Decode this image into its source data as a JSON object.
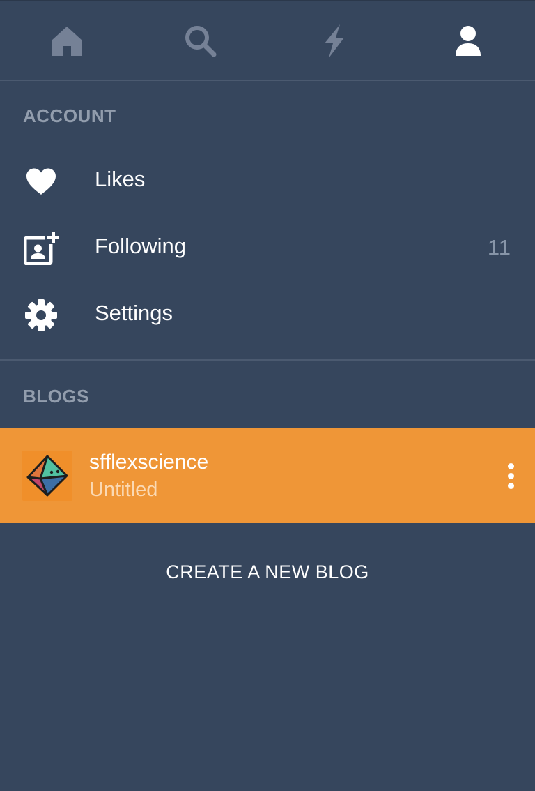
{
  "tabs": [
    {
      "icon": "home-icon",
      "active": false
    },
    {
      "icon": "search-icon",
      "active": false
    },
    {
      "icon": "lightning-icon",
      "active": false
    },
    {
      "icon": "person-icon",
      "active": true
    }
  ],
  "colors": {
    "background": "#36465d",
    "tab_inactive": "#758196",
    "tab_active": "#ffffff",
    "header_text": "#a3adbc",
    "blog_highlight": "#ef9637"
  },
  "account": {
    "header": "ACCOUNT",
    "items": [
      {
        "icon": "heart-icon",
        "label": "Likes",
        "count": ""
      },
      {
        "icon": "following-icon",
        "label": "Following",
        "count": "11"
      },
      {
        "icon": "gear-icon",
        "label": "Settings",
        "count": ""
      }
    ]
  },
  "blogs": {
    "header": "BLOGS",
    "items": [
      {
        "avatar": "octahedron-avatar-icon",
        "name": "sfflexscience",
        "title": "Untitled"
      }
    ],
    "create_label": "CREATE A NEW BLOG"
  }
}
